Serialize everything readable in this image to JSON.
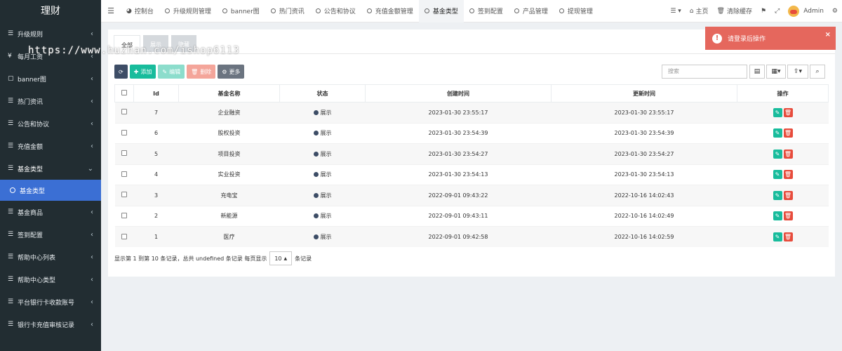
{
  "app": {
    "logo": "理财"
  },
  "watermark": "https://www.huzhan.com/ishop6113",
  "sidebar": {
    "items": [
      {
        "label": "升级规则",
        "icon": "list-icon"
      },
      {
        "label": "每月工资",
        "icon": "yen-icon"
      },
      {
        "label": "banner图",
        "icon": "image-icon"
      },
      {
        "label": "热门资讯",
        "icon": "list-icon"
      },
      {
        "label": "公告和协议",
        "icon": "list-icon"
      },
      {
        "label": "充值金额",
        "icon": "list-icon"
      },
      {
        "label": "基金类型",
        "icon": "list-icon"
      },
      {
        "label": "基金商品",
        "icon": "list-icon"
      },
      {
        "label": "签到配置",
        "icon": "list-icon"
      },
      {
        "label": "帮助中心列表",
        "icon": "list-icon"
      },
      {
        "label": "帮助中心类型",
        "icon": "list-icon"
      },
      {
        "label": "平台银行卡收款账号",
        "icon": "list-icon"
      },
      {
        "label": "银行卡充值审核记录",
        "icon": "list-icon"
      }
    ],
    "active_sub": "基金类型"
  },
  "topnav": {
    "tabs": [
      "控制台",
      "升级规则管理",
      "banner图",
      "热门资讯",
      "公告和协议",
      "充值金额管理",
      "基金类型",
      "签到配置",
      "产品管理",
      "提现管理"
    ],
    "active_tab": "基金类型",
    "home": "主页",
    "clear_cache": "清除缓存",
    "user": "Admin"
  },
  "content": {
    "filter_tabs": [
      "全部",
      "展示",
      "隐藏"
    ],
    "toolbar": {
      "add": "添加",
      "edit": "编辑",
      "delete": "删除",
      "more": "更多"
    },
    "search_placeholder": "搜索"
  },
  "table": {
    "headers": [
      "Id",
      "基金名称",
      "状态",
      "创建时间",
      "更新时间",
      "操作"
    ],
    "rows": [
      {
        "id": "7",
        "name": "企业融资",
        "status": "展示",
        "created": "2023-01-30 23:55:17",
        "updated": "2023-01-30 23:55:17"
      },
      {
        "id": "6",
        "name": "股权投资",
        "status": "展示",
        "created": "2023-01-30 23:54:39",
        "updated": "2023-01-30 23:54:39"
      },
      {
        "id": "5",
        "name": "项目投资",
        "status": "展示",
        "created": "2023-01-30 23:54:27",
        "updated": "2023-01-30 23:54:27"
      },
      {
        "id": "4",
        "name": "实业投资",
        "status": "展示",
        "created": "2023-01-30 23:54:13",
        "updated": "2023-01-30 23:54:13"
      },
      {
        "id": "3",
        "name": "充电宝",
        "status": "展示",
        "created": "2022-09-01 09:43:22",
        "updated": "2022-10-16 14:02:43"
      },
      {
        "id": "2",
        "name": "新能源",
        "status": "展示",
        "created": "2022-09-01 09:43:11",
        "updated": "2022-10-16 14:02:49"
      },
      {
        "id": "1",
        "name": "医疗",
        "status": "展示",
        "created": "2022-09-01 09:42:58",
        "updated": "2022-10-16 14:02:59"
      }
    ]
  },
  "pager": {
    "summary": "显示第 1 到第 10 条记录，总共 undefined 条记录 每页显示",
    "page_size": "10",
    "suffix": "条记录"
  },
  "toast": {
    "message": "请登录后操作"
  },
  "colors": {
    "sidebar": "#222d32",
    "active_sub": "#3b6fd4",
    "green": "#18bc9c",
    "red": "#e74c3c",
    "toast": "#e5675d"
  }
}
